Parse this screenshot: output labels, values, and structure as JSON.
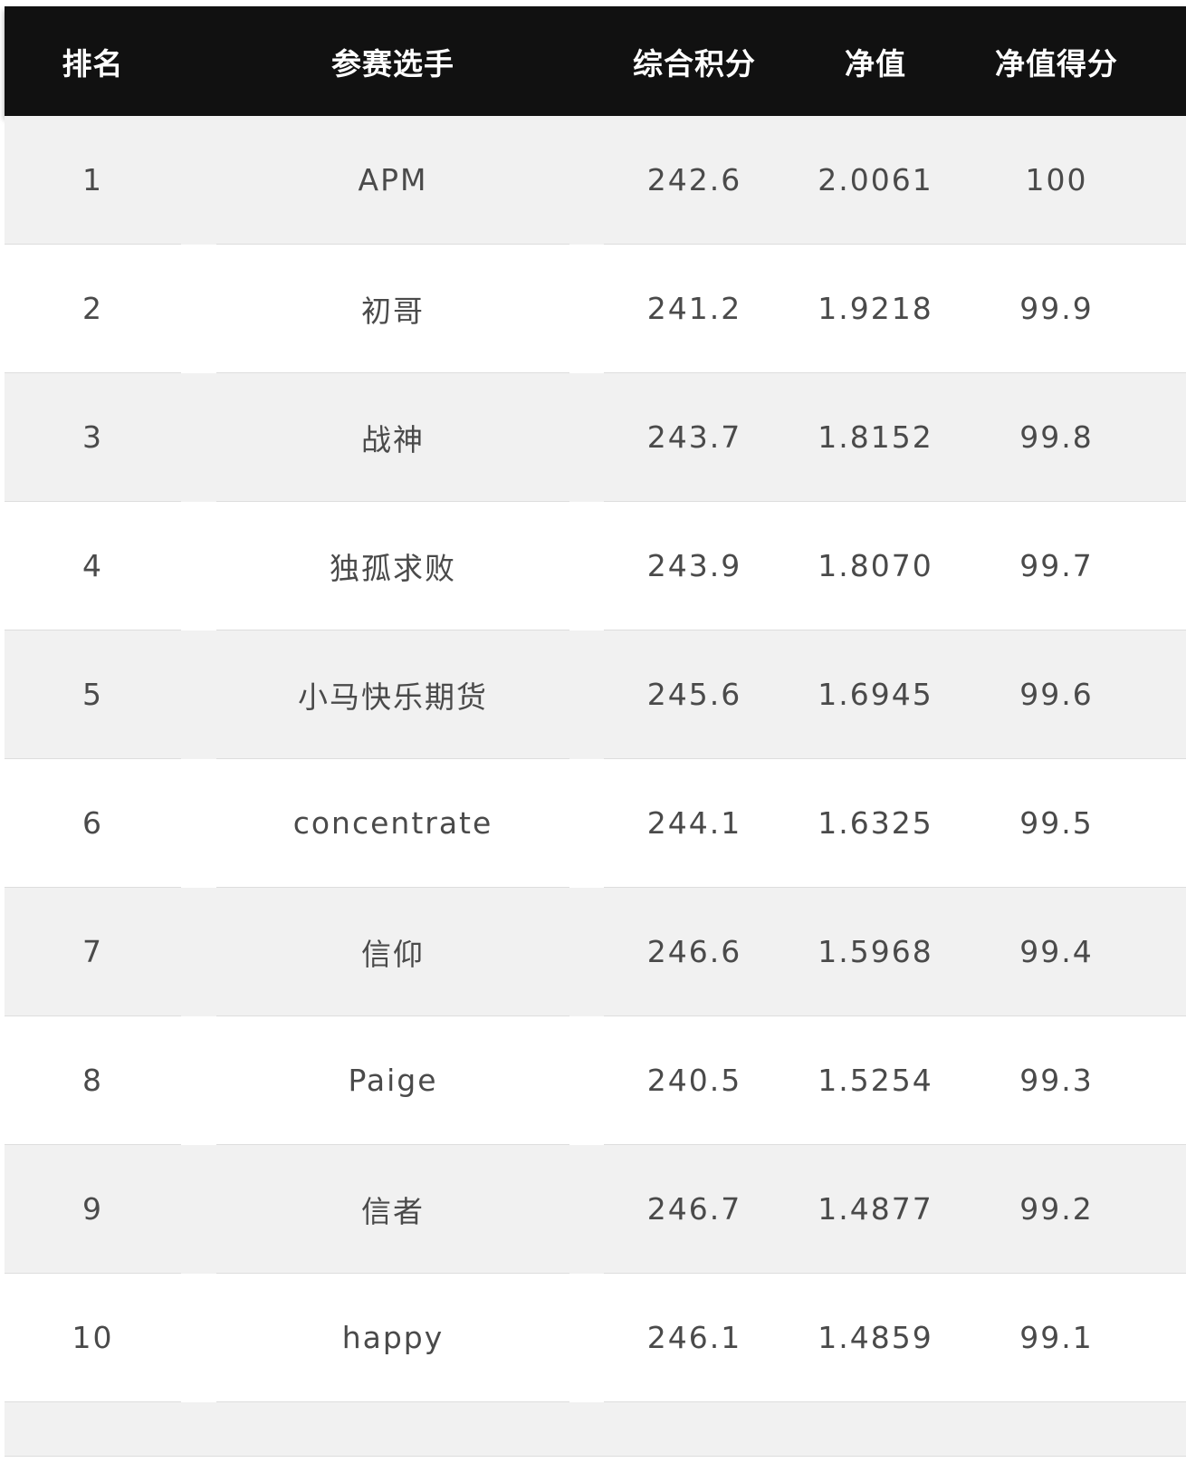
{
  "table": {
    "headers": {
      "rank": "排名",
      "player": "参赛选手",
      "total_score": "综合积分",
      "nav": "净值",
      "nav_score": "净值得分"
    },
    "rows": [
      {
        "rank": "1",
        "player": "APM",
        "total_score": "242.6",
        "nav": "2.0061",
        "nav_score": "100"
      },
      {
        "rank": "2",
        "player": "初哥",
        "total_score": "241.2",
        "nav": "1.9218",
        "nav_score": "99.9"
      },
      {
        "rank": "3",
        "player": "战神",
        "total_score": "243.7",
        "nav": "1.8152",
        "nav_score": "99.8"
      },
      {
        "rank": "4",
        "player": "独孤求败",
        "total_score": "243.9",
        "nav": "1.8070",
        "nav_score": "99.7"
      },
      {
        "rank": "5",
        "player": "小马快乐期货",
        "total_score": "245.6",
        "nav": "1.6945",
        "nav_score": "99.6"
      },
      {
        "rank": "6",
        "player": "concentrate",
        "total_score": "244.1",
        "nav": "1.6325",
        "nav_score": "99.5"
      },
      {
        "rank": "7",
        "player": "信仰",
        "total_score": "246.6",
        "nav": "1.5968",
        "nav_score": "99.4"
      },
      {
        "rank": "8",
        "player": "Paige",
        "total_score": "240.5",
        "nav": "1.5254",
        "nav_score": "99.3"
      },
      {
        "rank": "9",
        "player": "信者",
        "total_score": "246.7",
        "nav": "1.4877",
        "nav_score": "99.2"
      },
      {
        "rank": "10",
        "player": "happy",
        "total_score": "246.1",
        "nav": "1.4859",
        "nav_score": "99.1"
      }
    ]
  },
  "colors": {
    "header_bg": "#111111",
    "header_text": "#ffffff",
    "row_odd_bg": "#f1f1f1",
    "row_even_bg": "#ffffff",
    "cell_text": "#4a4a4a"
  }
}
